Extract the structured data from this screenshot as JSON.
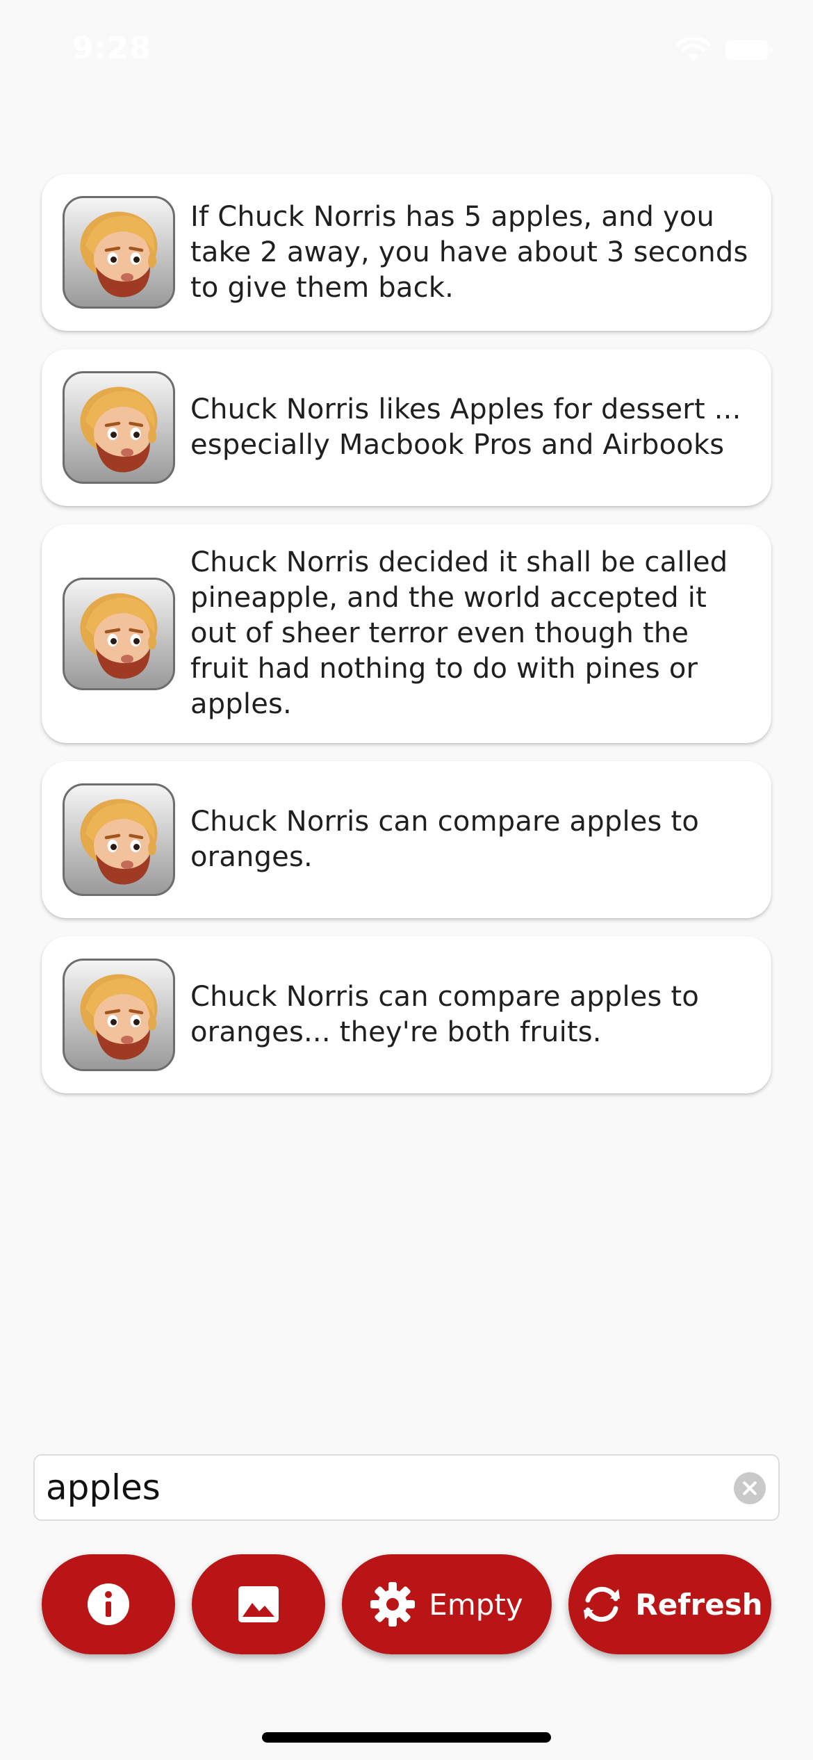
{
  "status_bar": {
    "time": "9:28"
  },
  "jokes": [
    {
      "text": "If Chuck Norris has 5 apples, and you take 2 away, you have about 3 seconds to give them back."
    },
    {
      "text": "Chuck Norris likes Apples for dessert ... especially Macbook Pros and Airbooks"
    },
    {
      "text": "Chuck Norris decided it shall be called pineapple, and the world accepted it out of sheer terror even though the fruit had nothing to do with pines or apples."
    },
    {
      "text": "Chuck Norris can compare apples to oranges."
    },
    {
      "text": "Chuck Norris can compare apples to oranges... they're both fruits."
    }
  ],
  "search": {
    "value": "apples"
  },
  "toolbar": {
    "info_icon": "info-icon",
    "image_icon": "image-icon",
    "settings_icon": "gear-icon",
    "empty_label": "Empty",
    "refresh_icon": "refresh-icon",
    "refresh_label": "Refresh"
  },
  "colors": {
    "accent": "#b91517",
    "background": "#f9f9f9",
    "card": "#ffffff"
  }
}
